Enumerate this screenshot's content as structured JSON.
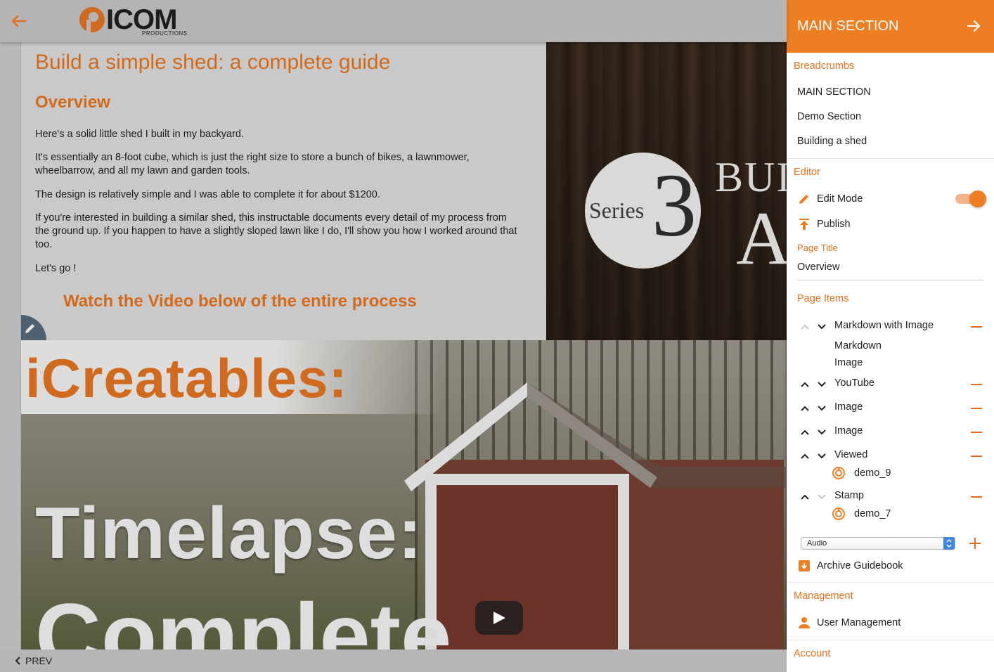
{
  "topbar": {
    "back_icon": "arrow-left-icon",
    "logo_text": "ICOM",
    "logo_sub": "PRODUCTIONS"
  },
  "content": {
    "page_heading": "Build a simple shed: a complete guide",
    "section_heading": "Overview",
    "paragraphs": [
      "Here's a solid little shed I built in my backyard.",
      "It's essentially an 8-foot cube, which is just the right size to store a bunch of bikes, a lawnmower, wheelbarrow, and all my lawn and garden tools.",
      "The design is relatively simple and I was able to complete it for about $1200.",
      "If you're interested in building a similar shed, this instructable documents every detail of my process from the ground up. If you happen to have a slightly sloped lawn like I do, I'll show you how I worked around that too.",
      "Let's go !"
    ],
    "video_heading": "Watch the Video below of the entire process"
  },
  "wood_image": {
    "series_text": "Series",
    "series_number": "3",
    "bui_text": "BUI",
    "a_text": "A"
  },
  "video": {
    "brand_text": "iCreatables:",
    "line1": "Timelapse:",
    "line2": "Complete",
    "play_icon": "play-icon"
  },
  "bottom": {
    "prev_label": "PREV"
  },
  "panel": {
    "title": "MAIN SECTION",
    "breadcrumbs_label": "Breadcrumbs",
    "breadcrumbs": [
      "MAIN SECTION",
      "Demo Section",
      "Building a shed"
    ],
    "editor_label": "Editor",
    "edit_mode_label": "Edit Mode",
    "edit_mode_on": true,
    "publish_label": "Publish",
    "page_title_label": "Page Title",
    "page_title_value": "Overview",
    "page_items_label": "Page Items",
    "items": [
      {
        "name": "Markdown with Image",
        "subs": [
          "Markdown",
          "Image"
        ]
      },
      {
        "name": "YouTube"
      },
      {
        "name": "Image"
      },
      {
        "name": "Image"
      },
      {
        "name": "Viewed",
        "demo": "demo_9"
      },
      {
        "name": "Stamp",
        "demo": "demo_7"
      }
    ],
    "select_value": "Audio",
    "archive_label": "Archive Guidebook",
    "management_label": "Management",
    "user_management_label": "User Management",
    "account_label": "Account",
    "accent_color": "#ee7e22"
  }
}
